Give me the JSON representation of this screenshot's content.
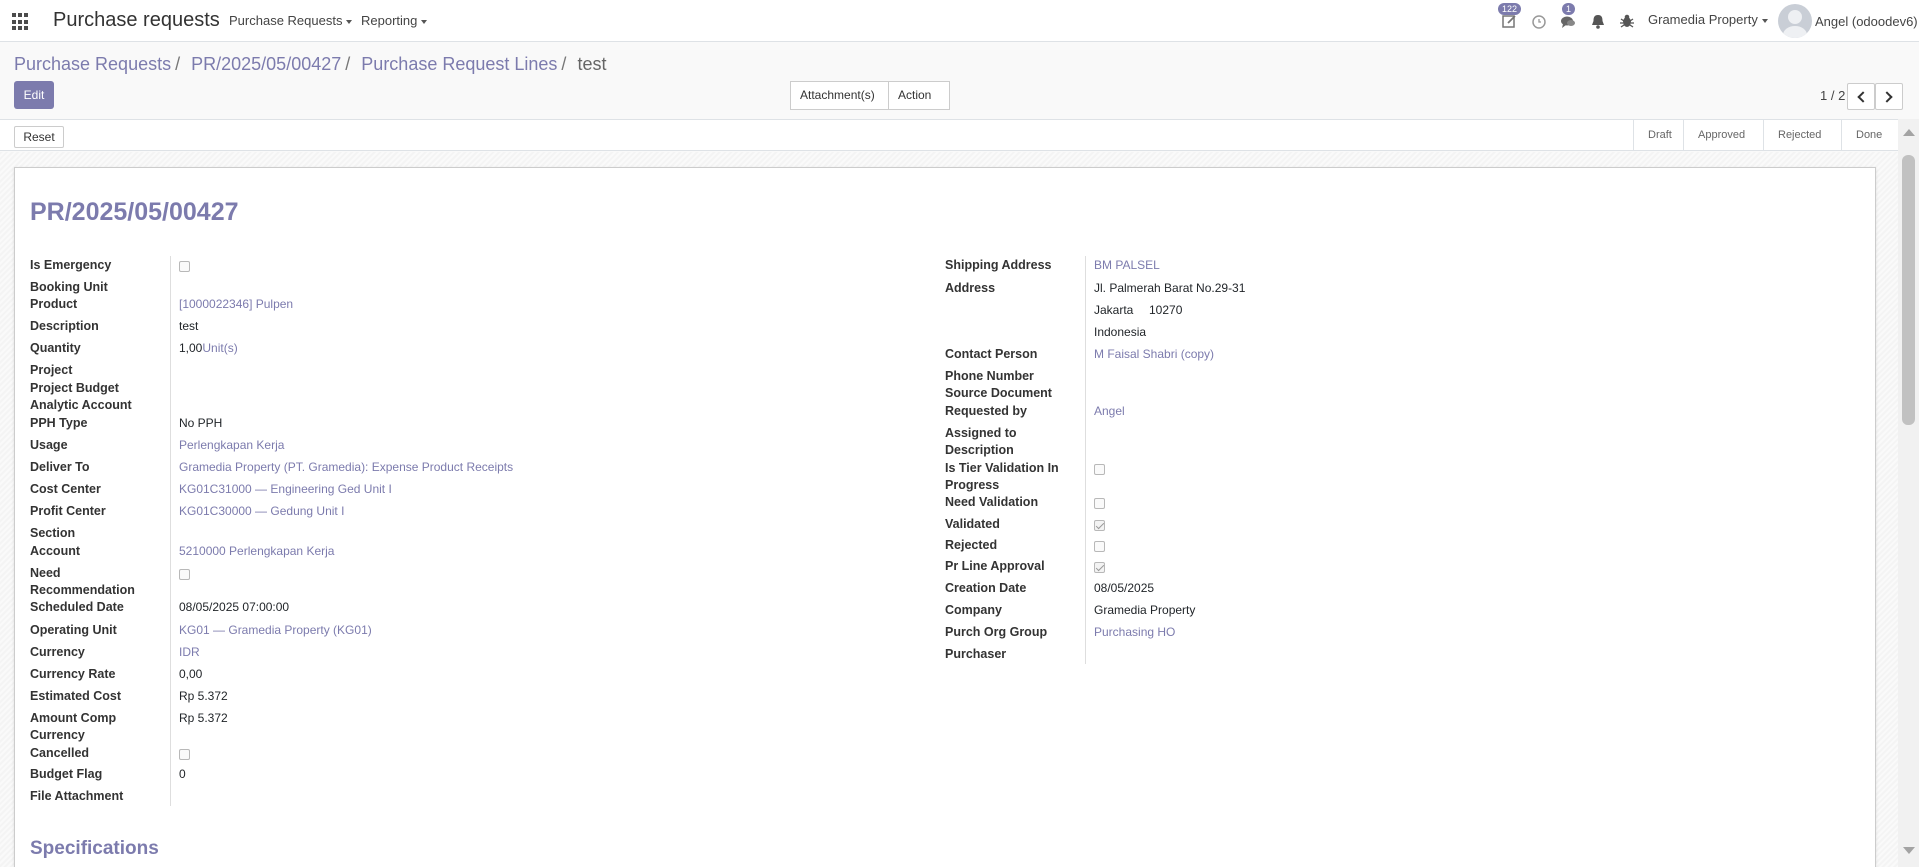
{
  "navbar": {
    "app_title": "Purchase requests",
    "menu_purchase_requests": "Purchase Requests",
    "menu_reporting": "Reporting",
    "activity_badge": "122",
    "messages_badge": "1",
    "company": "Gramedia Property",
    "user": "Angel (odoodev6)"
  },
  "breadcrumb": {
    "item1": "Purchase Requests",
    "item2": "PR/2025/05/00427",
    "item3": "Purchase Request Lines",
    "current": "test",
    "sep": "/"
  },
  "toolbar": {
    "edit": "Edit",
    "attachments": "Attachment(s)",
    "action": "Action",
    "pager": "1 / 2"
  },
  "statusbar": {
    "reset": "Reset",
    "stages": [
      "Draft",
      "Approved",
      "Rejected",
      "Done"
    ]
  },
  "record": {
    "title": "PR/2025/05/00427",
    "left": {
      "is_emergency": {
        "label": "Is Emergency",
        "checked": false
      },
      "booking_unit": {
        "label": "Booking Unit"
      },
      "product": {
        "label": "Product",
        "value": "[1000022346] Pulpen"
      },
      "description": {
        "label": "Description",
        "value": "test"
      },
      "quantity": {
        "label": "Quantity",
        "value": "1,00",
        "uom": "Unit(s)"
      },
      "project": {
        "label": "Project"
      },
      "project_budget": {
        "label": "Project Budget"
      },
      "analytic_account": {
        "label": "Analytic Account"
      },
      "pph_type": {
        "label": "PPH Type",
        "value": "No PPH"
      },
      "usage": {
        "label": "Usage",
        "value": "Perlengkapan Kerja"
      },
      "deliver_to": {
        "label": "Deliver To",
        "value": "Gramedia Property (PT. Gramedia): Expense Product Receipts"
      },
      "cost_center": {
        "label": "Cost Center",
        "value": "KG01C31000 — Engineering Ged Unit I"
      },
      "profit_center": {
        "label": "Profit Center",
        "value": "KG01C30000 — Gedung Unit I"
      },
      "section": {
        "label": "Section"
      },
      "account": {
        "label": "Account",
        "value": "5210000 Perlengkapan Kerja"
      },
      "need_recommendation": {
        "label_line1": "Need",
        "label_line2": "Recommendation",
        "checked": false
      },
      "scheduled_date": {
        "label": "Scheduled Date",
        "value": "08/05/2025 07:00:00"
      },
      "operating_unit": {
        "label": "Operating Unit",
        "value": "KG01 — Gramedia Property (KG01)"
      },
      "currency": {
        "label": "Currency",
        "value": "IDR"
      },
      "currency_rate": {
        "label": "Currency Rate",
        "value": "0,00"
      },
      "estimated_cost": {
        "label": "Estimated Cost",
        "value": "Rp 5.372"
      },
      "amount_comp_currency": {
        "label_line1": "Amount Comp",
        "label_line2": "Currency",
        "value": "Rp 5.372"
      },
      "cancelled": {
        "label": "Cancelled",
        "checked": false
      },
      "budget_flag": {
        "label": "Budget Flag",
        "value": "0"
      },
      "file_attachment": {
        "label": "File Attachment"
      }
    },
    "right": {
      "shipping_address": {
        "label": "Shipping Address",
        "value": "BM PALSEL"
      },
      "address": {
        "label": "Address",
        "street": "Jl. Palmerah Barat No.29-31",
        "city": "Jakarta",
        "zip": "10270",
        "country": "Indonesia"
      },
      "contact_person": {
        "label": "Contact Person",
        "value": "M Faisal Shabri (copy)"
      },
      "phone_number": {
        "label": "Phone Number"
      },
      "source_document": {
        "label": "Source Document"
      },
      "requested_by": {
        "label": "Requested by",
        "value": "Angel"
      },
      "assigned_to": {
        "label": "Assigned to"
      },
      "description": {
        "label": "Description"
      },
      "tier_validation": {
        "label_line1": "Is Tier Validation In",
        "label_line2": "Progress",
        "checked": false
      },
      "need_validation": {
        "label": "Need Validation",
        "checked": false
      },
      "validated": {
        "label": "Validated",
        "checked": true
      },
      "rejected": {
        "label": "Rejected",
        "checked": false
      },
      "pr_line_approval": {
        "label": "Pr Line Approval",
        "checked": true
      },
      "creation_date": {
        "label": "Creation Date",
        "value": "08/05/2025"
      },
      "company": {
        "label": "Company",
        "value": "Gramedia Property"
      },
      "purch_org_group": {
        "label": "Purch Org Group",
        "value": "Purchasing HO"
      },
      "purchaser": {
        "label": "Purchaser"
      }
    }
  },
  "specifications": {
    "title": "Specifications"
  },
  "colors": {
    "brand": "#7c7bad",
    "text": "#212529"
  }
}
